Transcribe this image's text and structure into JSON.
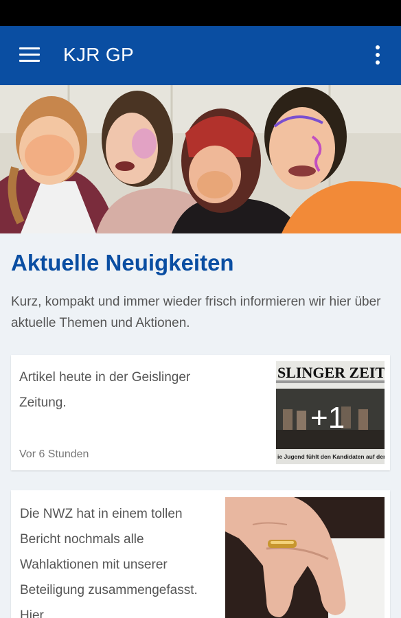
{
  "app_bar": {
    "title": "KJR GP",
    "menu_icon": "menu-icon",
    "overflow_icon": "more-vert-icon",
    "color": "#0a4ea2"
  },
  "hero": {
    "image": "photo-four-young-people-with-face-paint"
  },
  "section": {
    "title": "Aktuelle Neuigkeiten",
    "description": "Kurz, kompakt und immer wieder frisch informieren wir hier über aktuelle Themen und Aktionen."
  },
  "posts": [
    {
      "text": "Artikel heute in der Geislinger Zeitung.",
      "time": "Vor 6 Stunden",
      "image": "newspaper-clipping-photo",
      "newspaper_masthead": "SLINGER ZEIT",
      "newspaper_caption": "ie Jugend fühlt den Kandidaten auf den Z",
      "more_count": "+1"
    },
    {
      "text": "Die NWZ hat in einem tollen Bericht nochmals alle Wahlaktionen mit unserer Beteiligung zusammengefasst. Hier",
      "image": "hand-with-ring-photo"
    }
  ]
}
